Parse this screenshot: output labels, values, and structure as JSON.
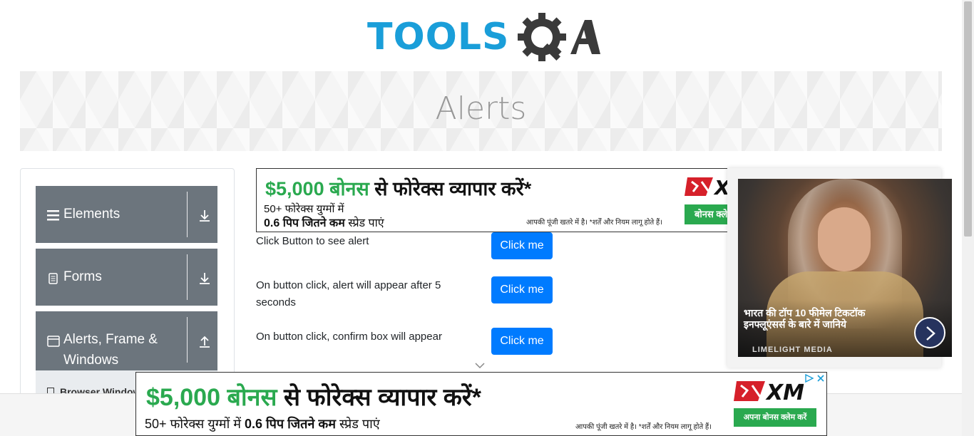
{
  "logo": {
    "text": "TOOLS",
    "suffix": "A"
  },
  "page": {
    "title": "Alerts"
  },
  "sidebar": {
    "groups": [
      {
        "label": "Elements",
        "icon": "hamburger-icon",
        "arrow": "download-arrow-icon"
      },
      {
        "label": "Forms",
        "icon": "document-icon",
        "arrow": "download-arrow-icon"
      },
      {
        "label": "Alerts, Frame & Windows",
        "icon": "window-icon",
        "arrow": "upload-arrow-icon"
      }
    ],
    "sub_item": {
      "label": "Browser Windows",
      "icon": "document-icon"
    }
  },
  "ad_top": {
    "headline_green": "$5,000 बोनस",
    "headline_rest": " से फोरेक्स व्यापार करें*",
    "line2": "50+ फोरेक्स युग्मों में",
    "line3_bold": "0.6 पिप जितने कम",
    "line3_rest": " स्प्रेड पाएं",
    "disclaimer": "आपकी पूंजी खतरे में है। *शर्तें और नियम लागू होते हैं।",
    "button": "बोनस क्ले"
  },
  "alerts": [
    {
      "label": "Click Button to see alert",
      "button": "Click me"
    },
    {
      "label": "On button click, alert will appear after 5 seconds",
      "button": "Click me"
    },
    {
      "label": "On button click, confirm box will appear",
      "button": "Click me"
    }
  ],
  "video_ad": {
    "caption": "भारत की टॉप 10 फीमेल टिकटॉक इनफ्लूएंसर्स के बारे में जानिये",
    "brand": "LIMELIGHT MEDIA"
  },
  "ad_bottom": {
    "headline_green": "$5,000 बोनस",
    "headline_rest": " से फोरेक्स व्यापार करें*",
    "line2_a": "50+ फोरेक्स युग्मों में ",
    "line2_bold": "0.6 पिप जितने कम",
    "line2_b": " स्प्रेड पाएं",
    "disclaimer": "आपकी पूंजी खतरे में है। *शर्तें और नियम लागू होते हैं।",
    "button": "अपना बोनस क्लेम करें"
  },
  "colors": {
    "brand_blue": "#1a9ed9",
    "button_blue": "#007bff",
    "sidebar_gray": "#6c757d",
    "ad_green": "#2aa94f",
    "xm_red": "#d6202a"
  }
}
